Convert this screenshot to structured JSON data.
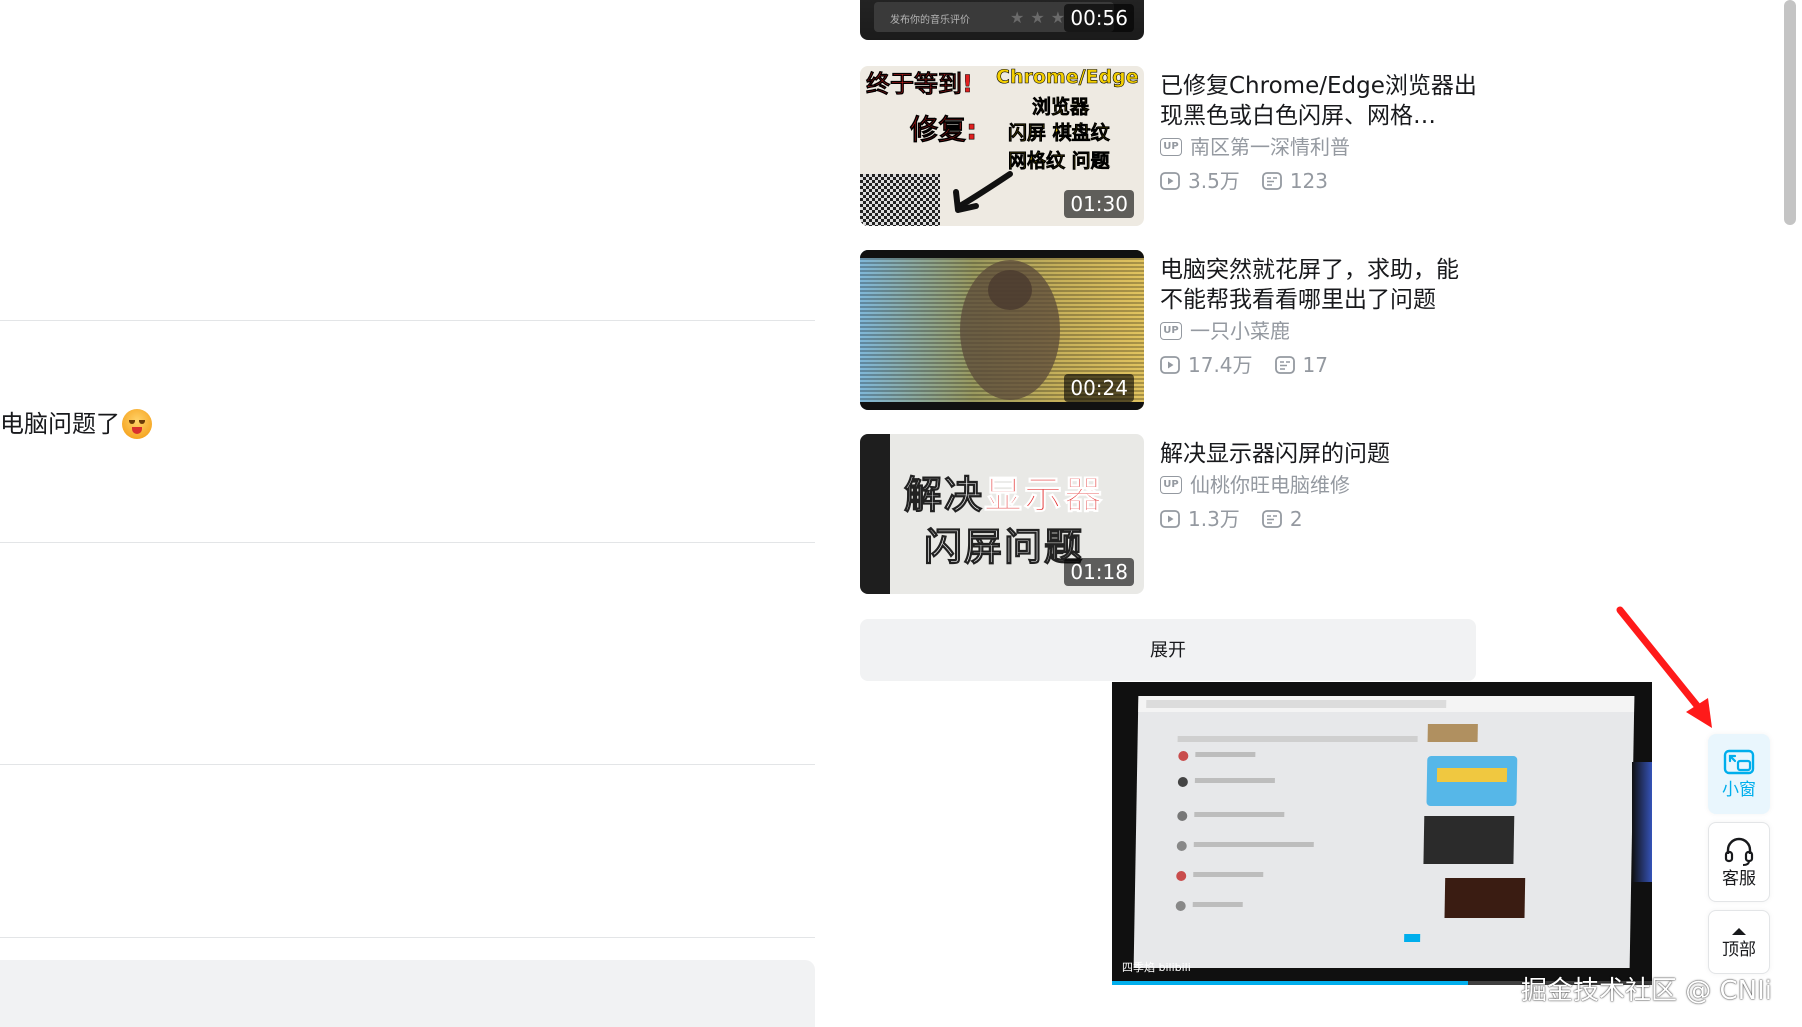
{
  "comment": {
    "partial_text": "电脑问题了"
  },
  "related_videos": [
    {
      "duration": "00:56",
      "thumb_caption": "发布你的音乐评价"
    },
    {
      "title": "已修复Chrome/Edge浏览器出现黑色或白色闪屏、网格…",
      "uploader": "南区第一深情利普",
      "views": "3.5万",
      "danmaku": "123",
      "duration": "01:30",
      "thumb_text": {
        "line1": "终于等到!",
        "line1b": "Chrome/Edge",
        "line2": "浏览器",
        "line3a": "修复:",
        "line3b": "闪屏 棋盘纹",
        "line4": "网格纹 问题"
      }
    },
    {
      "title": "电脑突然就花屏了，求助，能不能帮我看看哪里出了问题",
      "uploader": "一只小菜鹿",
      "views": "17.4万",
      "danmaku": "17",
      "duration": "00:24"
    },
    {
      "title": "解决显示器闪屏的问题",
      "uploader": "仙桃你旺电脑维修",
      "views": "1.3万",
      "danmaku": "2",
      "duration": "01:18",
      "thumb_text": {
        "line1a": "解决",
        "line1b": "显示器",
        "line2": "闪屏问题"
      }
    }
  ],
  "expand_label": "展开",
  "mini_player": {
    "watermark": "四季焰 bilibili",
    "progress_percent": 66
  },
  "side_tools": {
    "mini_window": "小窗",
    "customer_service": "客服",
    "top": "顶部"
  },
  "badge_up": "UP",
  "watermark": "掘金技术社区 @ CNIi",
  "colors": {
    "accent": "#00aeec",
    "text_secondary": "#9499a0",
    "arrow": "#ff1a1a"
  }
}
